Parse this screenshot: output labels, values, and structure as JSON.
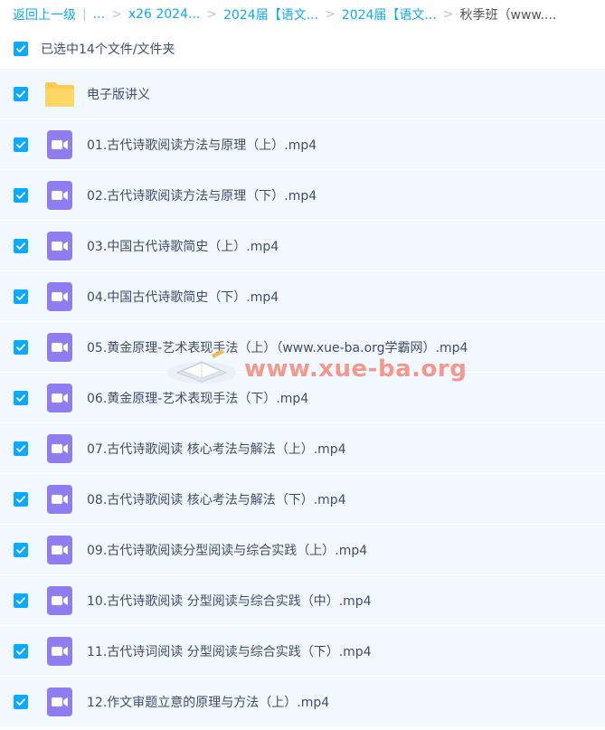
{
  "breadcrumb": {
    "back": "返回上一级",
    "divider": "|",
    "ellipsis": "...",
    "separator": ">",
    "crumbs": [
      "x26 2024...",
      "2024届【语文...",
      "2024届【语文..."
    ],
    "current": "秋季班（www...."
  },
  "selection": {
    "label": "已选中14个文件/文件夹",
    "checked": true
  },
  "files": [
    {
      "name": "电子版讲义",
      "type": "folder",
      "checked": true
    },
    {
      "name": "01.古代诗歌阅读方法与原理（上）.mp4",
      "type": "video",
      "checked": true
    },
    {
      "name": "02.古代诗歌阅读方法与原理（下）.mp4",
      "type": "video",
      "checked": true
    },
    {
      "name": "03.中国古代诗歌简史（上）.mp4",
      "type": "video",
      "checked": true
    },
    {
      "name": "04.中国古代诗歌简史（下）.mp4",
      "type": "video",
      "checked": true
    },
    {
      "name": "05.黄金原理-艺术表现手法（上）（www.xue-ba.org学霸网）.mp4",
      "type": "video",
      "checked": true
    },
    {
      "name": "06.黄金原理-艺术表现手法（下）.mp4",
      "type": "video",
      "checked": true
    },
    {
      "name": "07.古代诗歌阅读 核心考法与解法（上）.mp4",
      "type": "video",
      "checked": true
    },
    {
      "name": "08.古代诗歌阅读 核心考法与解法（下）.mp4",
      "type": "video",
      "checked": true
    },
    {
      "name": "09.古代诗歌阅读分型阅读与综合实践（上）.mp4",
      "type": "video",
      "checked": true
    },
    {
      "name": "10.古代诗歌阅读 分型阅读与综合实践（中）.mp4",
      "type": "video",
      "checked": true
    },
    {
      "name": "11.古代诗词阅读 分型阅读与综合实践（下）.mp4",
      "type": "video",
      "checked": true
    },
    {
      "name": "12.作文审题立意的原理与方法（上）.mp4",
      "type": "video",
      "checked": true
    }
  ],
  "watermark": {
    "text": "www.xue-ba.org",
    "icon": "book-logo-icon"
  },
  "colors": {
    "accent": "#09AAFF",
    "row_bg": "#f1f8ff",
    "folder": "#FFCB4D",
    "video": "#8E7CF0",
    "text": "#424e67"
  }
}
